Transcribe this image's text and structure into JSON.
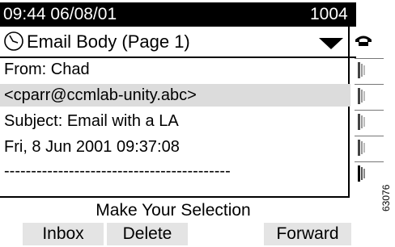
{
  "status_bar": {
    "datetime": "09:44 06/08/01",
    "extension": "1004"
  },
  "header": {
    "title": "Email Body (Page 1)",
    "icon": "clock-icon",
    "dropdown_icon": "down-triangle-icon"
  },
  "line_button": {
    "icon": "phone-handset-icon"
  },
  "content": {
    "lines": [
      "From: Chad",
      "<cparr@ccmlab-unity.abc>",
      "Subject: Email with a LA",
      "Fri, 8 Jun 2001 09:37:08",
      "------------------------------------------"
    ]
  },
  "prompt": "Make Your Selection",
  "softkeys": [
    "Inbox",
    "Delete",
    "Forward"
  ],
  "figure_id": "63076"
}
